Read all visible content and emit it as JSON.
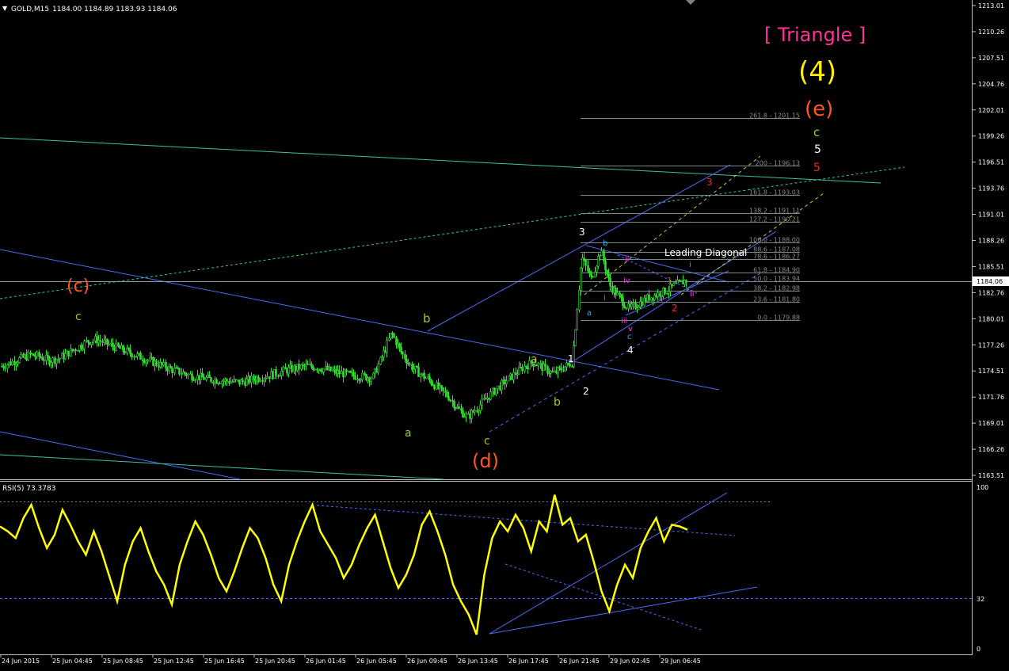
{
  "header": {
    "symbol_menu": "▼",
    "symbol": "GOLD,M15",
    "ohlc": "1184.00 1184.89 1183.93 1184.06"
  },
  "indicator": {
    "label": "RSI(5) 73.3783",
    "levels": [
      "100",
      "32",
      "0"
    ]
  },
  "price_axis": {
    "ticks": [
      "1213.01",
      "1210.26",
      "1207.51",
      "1204.76",
      "1202.01",
      "1199.26",
      "1196.51",
      "1193.76",
      "1191.01",
      "1188.26",
      "1185.51",
      "1182.76",
      "1180.01",
      "1177.26",
      "1174.51",
      "1171.76",
      "1169.01",
      "1166.26",
      "1163.51"
    ],
    "current_price": "1184.06"
  },
  "time_axis": {
    "ticks": [
      "24 Jun 2015",
      "25 Jun 04:45",
      "25 Jun 08:45",
      "25 Jun 12:45",
      "25 Jun 16:45",
      "25 Jun 20:45",
      "26 Jun 01:45",
      "26 Jun 05:45",
      "26 Jun 09:45",
      "26 Jun 13:45",
      "26 Jun 17:45",
      "26 Jun 21:45",
      "29 Jun 02:45",
      "29 Jun 06:45"
    ]
  },
  "fib_levels": [
    "261.8 - 1201.15",
    "200 - 1196.13",
    "161.8 - 1193.03",
    "138.2 - 1191.11",
    "127.2 - 1190.21",
    "100.0 - 1188.00",
    "88.6 - 1187.08",
    "78.6 - 1186.27",
    "61.8 - 1184.90",
    "50.0 - 1183.94",
    "38.2 - 1182.98",
    "23.6 - 1181.80",
    "0.0 - 1179.88"
  ],
  "annotations": {
    "triangle": "[ Triangle ]",
    "wave4": "(4)",
    "wave_e": "(e)",
    "e_c": "c",
    "e_5": "5",
    "e_5_red": "5",
    "wave_c_left": "(c)",
    "c_small": "c",
    "b_top": "b",
    "a_low": "a",
    "c_low": "c",
    "wave_d": "(d)",
    "a_mid": "a",
    "b_mid": "b",
    "w1": "1",
    "w2": "2",
    "w3": "3",
    "w3_red": "3",
    "w4": "4",
    "leading_diagonal": "Leading Diagonal",
    "sub_b": "b",
    "sub_a": "a",
    "sub_c": "c",
    "sub_i": "i",
    "sub_ii": "ii",
    "sub_iii": "iii",
    "sub_iv": "iv",
    "sub_v": "v",
    "sub_i_right": "i",
    "sub_ii_right": "ii",
    "red_1": "1",
    "red_2": "2"
  },
  "colors": {
    "background": "#000000",
    "candle": "#33dd33",
    "rsi": "#ffff00",
    "trendline": "#4a6cf7",
    "channel": "#5a7bff",
    "wave_orange": "#ff5522",
    "wave_yellow": "#ffee00",
    "triangle_pink": "#ff3399",
    "label_green": "#99cc33",
    "fib_text": "#888888"
  },
  "chart_data": [
    {
      "type": "candlestick",
      "title": "GOLD,M15",
      "ylim": [
        1163.5,
        1213.0
      ],
      "price_series_approx": [
        1175.0,
        1175.4,
        1175.8,
        1176.2,
        1176.0,
        1175.6,
        1175.8,
        1176.4,
        1177.0,
        1177.6,
        1177.8,
        1177.4,
        1177.0,
        1176.6,
        1176.2,
        1175.8,
        1175.4,
        1175.0,
        1174.6,
        1174.3,
        1174.0,
        1173.8,
        1173.6,
        1173.5,
        1173.4,
        1173.3,
        1173.5,
        1173.8,
        1174.0,
        1174.3,
        1174.6,
        1174.8,
        1175.0,
        1174.9,
        1174.7,
        1174.4,
        1174.2,
        1174.0,
        1173.9,
        1173.8,
        1176.0,
        1178.5,
        1176.5,
        1175.0,
        1174.2,
        1173.5,
        1172.6,
        1171.8,
        1170.5,
        1169.6,
        1170.6,
        1171.6,
        1172.6,
        1173.4,
        1174.2,
        1175.0,
        1175.4,
        1174.8,
        1174.2,
        1174.8,
        1175.4,
        1186.5,
        1184.2,
        1187.2,
        1183.5,
        1182.2,
        1181.0,
        1181.6,
        1182.2,
        1182.6,
        1183.0,
        1183.6,
        1184.06
      ],
      "annotated_points": [
        {
          "label": "(c)",
          "price": 1178.5
        },
        {
          "label": "b",
          "price": 1178.4
        },
        {
          "label": "a",
          "price": 1171.0
        },
        {
          "label": "c / (d)",
          "price": 1169.5
        },
        {
          "label": "3",
          "price": 1188.2
        },
        {
          "label": "4",
          "price": 1180.0
        }
      ]
    },
    {
      "type": "line",
      "title": "RSI(5) 73.3783",
      "ylim": [
        0,
        100
      ],
      "levels": [
        32,
        90
      ],
      "last_value": 73.3783,
      "values_approx": [
        75,
        72,
        68,
        80,
        88,
        74,
        62,
        70,
        85,
        76,
        66,
        58,
        72,
        60,
        45,
        30,
        52,
        66,
        74,
        60,
        48,
        40,
        28,
        52,
        66,
        78,
        70,
        58,
        44,
        36,
        48,
        62,
        74,
        68,
        56,
        40,
        30,
        52,
        66,
        78,
        88,
        72,
        64,
        56,
        44,
        52,
        64,
        74,
        82,
        66,
        50,
        38,
        46,
        58,
        76,
        84,
        72,
        58,
        40,
        30,
        22,
        10,
        46,
        68,
        78,
        72,
        82,
        74,
        60,
        78,
        72,
        94,
        76,
        80,
        66,
        70,
        54,
        36,
        24,
        40,
        52,
        44,
        62,
        72,
        80,
        66,
        76,
        75,
        73
      ]
    }
  ]
}
